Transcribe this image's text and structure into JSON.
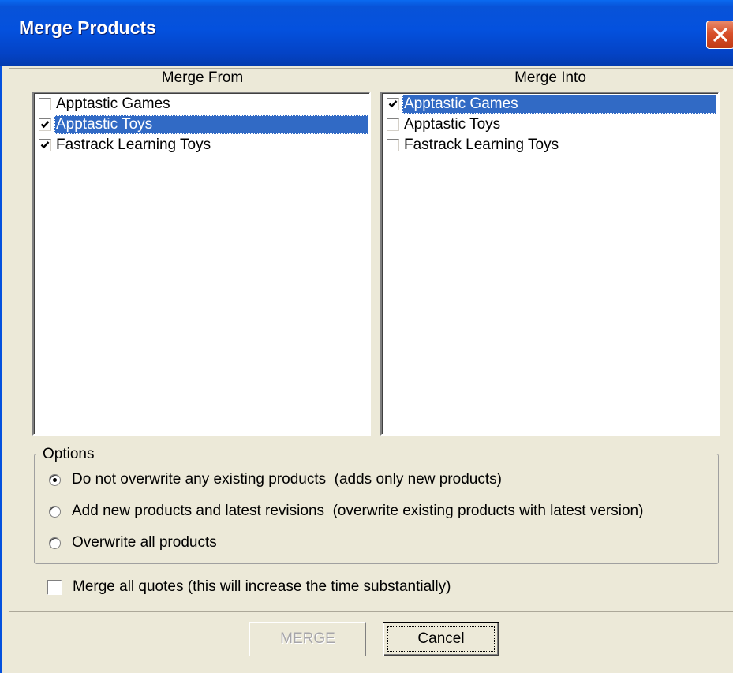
{
  "window": {
    "title": "Merge Products"
  },
  "merge_from": {
    "header": "Merge From",
    "items": [
      {
        "label": "Apptastic Games",
        "checked": false,
        "selected": false
      },
      {
        "label": "Apptastic Toys",
        "checked": true,
        "selected": true
      },
      {
        "label": "Fastrack Learning Toys",
        "checked": true,
        "selected": false
      }
    ]
  },
  "merge_into": {
    "header": "Merge Into",
    "items": [
      {
        "label": "Apptastic Games",
        "checked": true,
        "selected": true
      },
      {
        "label": "Apptastic Toys",
        "checked": false,
        "selected": false
      },
      {
        "label": "Fastrack Learning Toys",
        "checked": false,
        "selected": false
      }
    ]
  },
  "options": {
    "legend": "Options",
    "radios": [
      {
        "label": "Do not overwrite any existing products  (adds only new products)",
        "checked": true
      },
      {
        "label": "Add new products and latest revisions  (overwrite existing products with latest version)",
        "checked": false
      },
      {
        "label": "Overwrite all products",
        "checked": false
      }
    ]
  },
  "merge_quotes": {
    "label": "Merge all quotes (this will increase the time substantially)",
    "checked": false
  },
  "buttons": {
    "merge": "MERGE",
    "cancel": "Cancel"
  },
  "colors": {
    "titlebar": "#0451DE",
    "selection": "#316AC5",
    "dialog_bg": "#ECE9D8",
    "close": "#D8502B"
  },
  "icons": {
    "close": "close-icon",
    "check": "checkmark-icon"
  }
}
